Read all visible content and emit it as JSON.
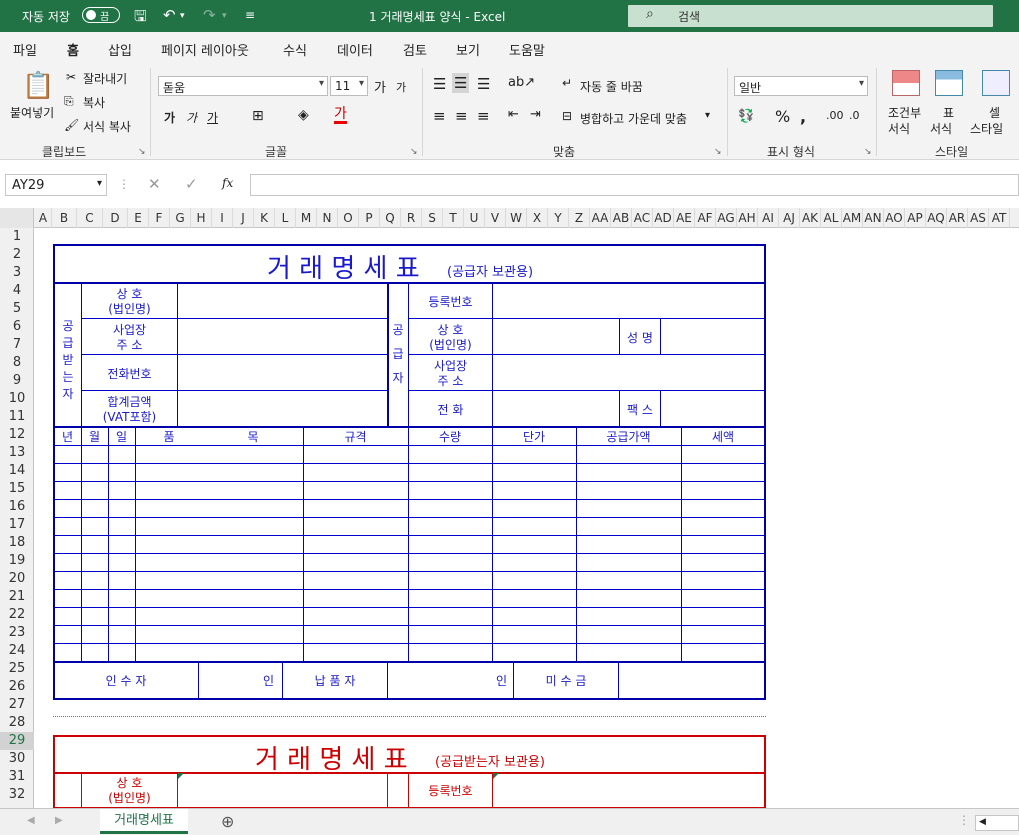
{
  "titlebar": {
    "autosave": "자동 저장",
    "toggle": "끔",
    "title": "1 거래명세표 양식  -  Excel",
    "search": "검색"
  },
  "tabs": [
    "파일",
    "홈",
    "삽입",
    "페이지 레이아웃",
    "수식",
    "데이터",
    "검토",
    "보기",
    "도움말"
  ],
  "ribbon": {
    "clipboard": {
      "paste": "붙여넣기",
      "cut": "잘라내기",
      "copy": "복사",
      "format_painter": "서식 복사",
      "group": "클립보드"
    },
    "font": {
      "name": "돋움",
      "size": "11",
      "bold": "가",
      "italic": "가",
      "underline": "가",
      "grow": "가",
      "shrink": "가",
      "group": "글꼴"
    },
    "align": {
      "wrap": "자동 줄 바꿈",
      "merge": "병합하고 가운데 맞춤",
      "group": "맞춤"
    },
    "number": {
      "format": "일반",
      "group": "표시 형식"
    },
    "styles": {
      "cond": "조건부",
      "cond2": "서식",
      "table": "표",
      "table2": "서식",
      "cell": "셀",
      "cell2": "스타일",
      "group": "스타일"
    }
  },
  "formula": {
    "namebox": "AY29",
    "fx": "fx"
  },
  "columns": [
    "A",
    "B",
    "C",
    "D",
    "E",
    "F",
    "G",
    "H",
    "I",
    "J",
    "K",
    "L",
    "M",
    "N",
    "O",
    "P",
    "Q",
    "R",
    "S",
    "T",
    "U",
    "V",
    "W",
    "X",
    "Y",
    "Z",
    "AA",
    "AB",
    "AC",
    "AD",
    "AE",
    "AF",
    "AG",
    "AH",
    "AI",
    "AJ",
    "AK",
    "AL",
    "AM",
    "AN",
    "AO",
    "AP",
    "AQ",
    "AR",
    "AS",
    "AT"
  ],
  "rows": [
    "1",
    "2",
    "3",
    "4",
    "5",
    "6",
    "7",
    "8",
    "9",
    "10",
    "11",
    "12",
    "13",
    "14",
    "15",
    "16",
    "17",
    "18",
    "19",
    "20",
    "21",
    "22",
    "23",
    "24",
    "25",
    "26",
    "27",
    "28",
    "29",
    "30",
    "31",
    "32"
  ],
  "invoice1": {
    "title": "거 래 명 세 표",
    "sub": "(공급자 보관용)",
    "buyer": "공급받는자",
    "supplier": "공급자",
    "name": "상 호",
    "corp": "(법인명)",
    "addr": "사업장",
    "addr2": "주 소",
    "phone": "전화번호",
    "total": "합계금액",
    "vat": "(VAT포함)",
    "regno": "등록번호",
    "ceo": "성 명",
    "tel": "전 화",
    "fax": "팩 스",
    "headers": [
      "년",
      "월",
      "일",
      "품",
      "목",
      "규격",
      "수량",
      "단가",
      "공급가액",
      "세액"
    ],
    "receiver": "인 수 자",
    "seal": "인",
    "deliverer": "납 품 자",
    "unpaid": "미 수 금"
  },
  "invoice2": {
    "title": "거 래 명 세 표",
    "sub": "(공급받는자 보관용)",
    "name": "상 호",
    "corp": "(법인명)",
    "regno": "등록번호"
  },
  "status": {
    "sheet": "거래명세표"
  }
}
